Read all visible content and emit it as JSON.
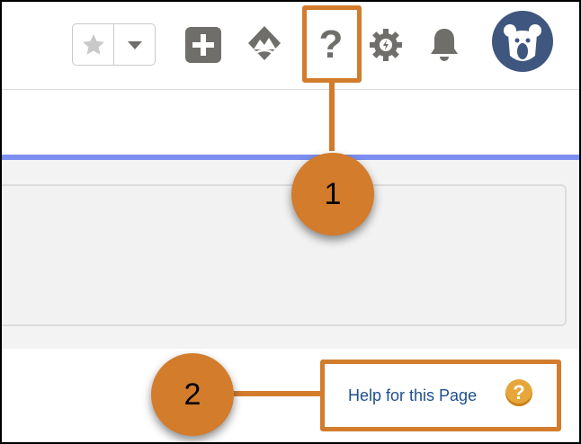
{
  "header": {
    "favorites_star_icon": "star-icon",
    "favorites_menu_icon": "chevron-down-icon",
    "icons": [
      "plus-icon",
      "trailhead-icon",
      "help-icon",
      "gear-icon",
      "bell-icon"
    ],
    "help_glyph": "?",
    "avatar_icon": "bear-avatar-icon"
  },
  "main": {
    "help_link_label": "Help for this Page",
    "help_link_icon_glyph": "?"
  },
  "callouts": [
    {
      "number": "1"
    },
    {
      "number": "2"
    }
  ],
  "colors": {
    "callout": "#d27c2c",
    "accent_bar": "#7c8ff0",
    "link": "#1e4f8c",
    "icon_gray": "#706e6b",
    "avatar_bg": "#3f567f",
    "help_circle": "#e6a63a"
  }
}
